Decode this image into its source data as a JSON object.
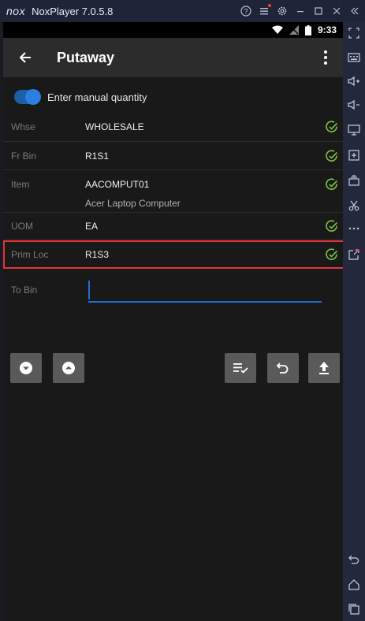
{
  "window": {
    "logo": "nox",
    "title": "NoxPlayer 7.0.5.8",
    "controls": [
      "help-icon",
      "menu-icon",
      "settings-icon",
      "minimize-icon",
      "maximize-icon",
      "close-icon",
      "collapse-sidebar-icon"
    ]
  },
  "statusbar": {
    "time": "9:33"
  },
  "appbar": {
    "title": "Putaway"
  },
  "toggle": {
    "label": "Enter manual quantity",
    "on": true
  },
  "fields": {
    "whse": {
      "label": "Whse",
      "value": "WHOLESALE"
    },
    "fr_bin": {
      "label": "Fr Bin",
      "value": "R1S1"
    },
    "item": {
      "label": "Item",
      "value": "AACOMPUT01",
      "description": "Acer Laptop Computer"
    },
    "uom": {
      "label": "UOM",
      "value": "EA"
    },
    "prim_loc": {
      "label": "Prim Loc",
      "value": "R1S3"
    }
  },
  "to_bin": {
    "label": "To Bin",
    "value": ""
  },
  "buttons": {
    "down": "chevron-down-icon",
    "up": "chevron-up-icon",
    "list": "list-check-icon",
    "undo": "undo-icon",
    "upload": "upload-icon"
  },
  "colors": {
    "accent": "#2a7fe0",
    "check": "#7dc242",
    "highlight": "#e2353d"
  }
}
